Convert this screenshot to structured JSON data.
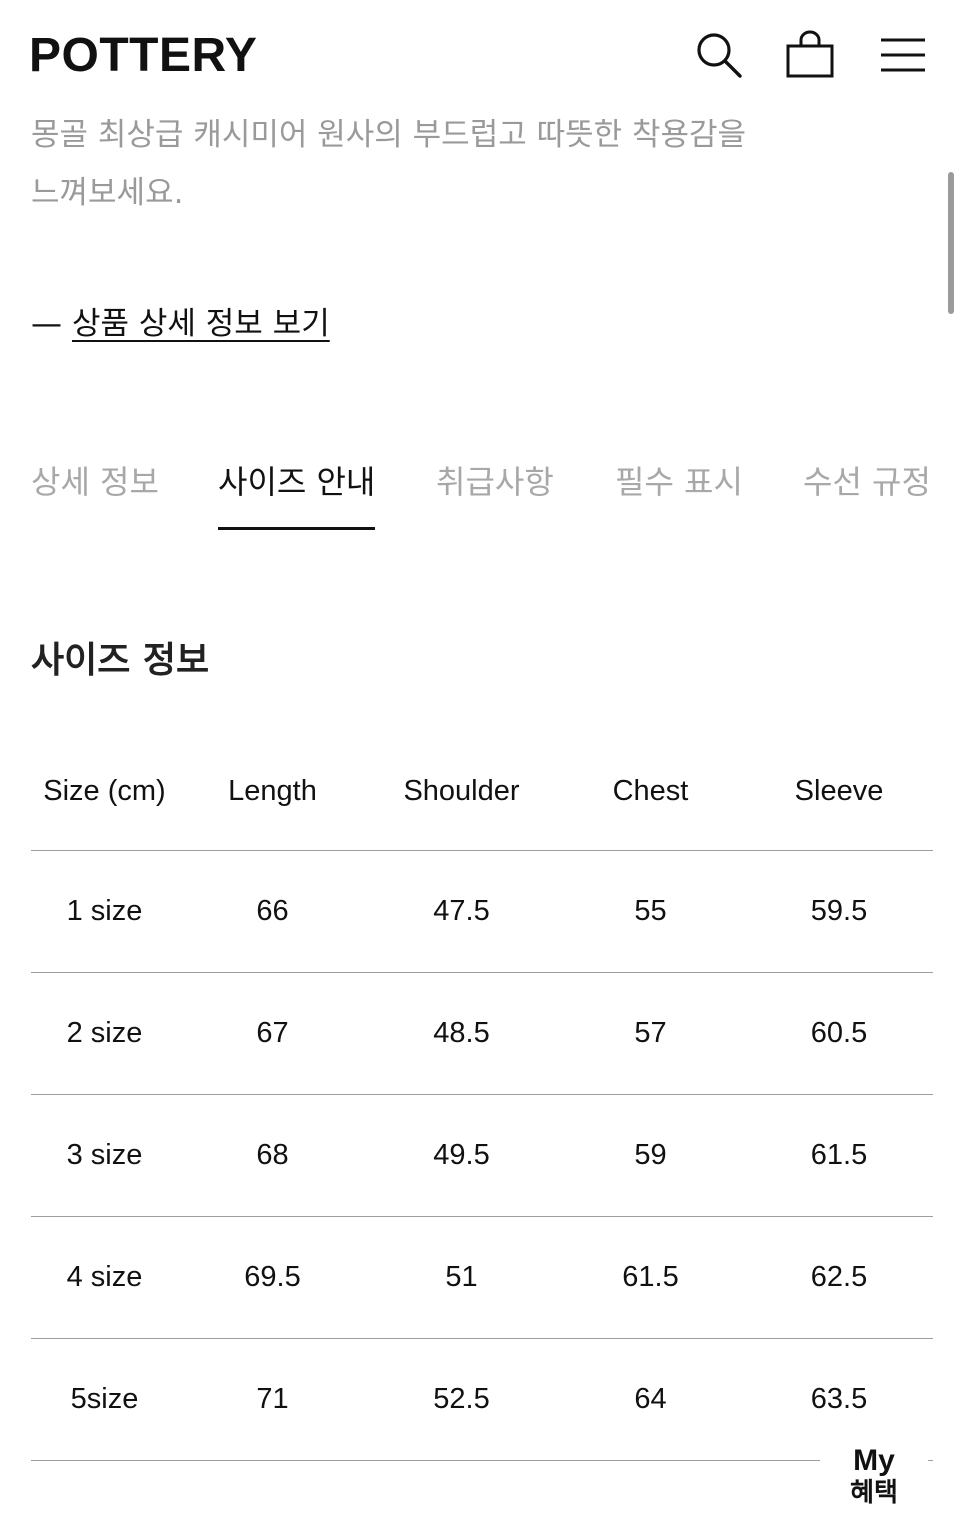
{
  "header": {
    "logo": "POTTERY",
    "icons": [
      "search-icon",
      "shopping-bag-icon",
      "hamburger-menu-icon"
    ]
  },
  "product": {
    "description_line1": "몽골 최상급 캐시미어 원사의 부드럽고 따뜻한 착용감을",
    "description_line2": "느껴보세요.",
    "detail_link_dash": "—",
    "detail_link_label": "상품 상세 정보 보기"
  },
  "tabs": [
    {
      "label": "상세 정보",
      "active": false
    },
    {
      "label": "사이즈 안내",
      "active": true
    },
    {
      "label": "취급사항",
      "active": false
    },
    {
      "label": "필수 표시",
      "active": false
    },
    {
      "label": "수선 규정",
      "active": false
    }
  ],
  "size_section": {
    "title": "사이즈 정보",
    "headers": [
      "Size (cm)",
      "Length",
      "Shoulder",
      "Chest",
      "Sleeve"
    ],
    "rows": [
      [
        "1 size",
        "66",
        "47.5",
        "55",
        "59.5"
      ],
      [
        "2 size",
        "67",
        "48.5",
        "57",
        "60.5"
      ],
      [
        "3 size",
        "68",
        "49.5",
        "59",
        "61.5"
      ],
      [
        "4 size",
        "69.5",
        "51",
        "61.5",
        "62.5"
      ],
      [
        "5size",
        "71",
        "52.5",
        "64",
        "63.5"
      ]
    ]
  },
  "floating_button": {
    "line1": "My",
    "line2": "혜택"
  },
  "colors": {
    "text": "#111111",
    "muted": "#9a9a9a",
    "inactive_tab": "#a8a8a8",
    "divider": "#9d9d9d",
    "background": "#ffffff"
  }
}
